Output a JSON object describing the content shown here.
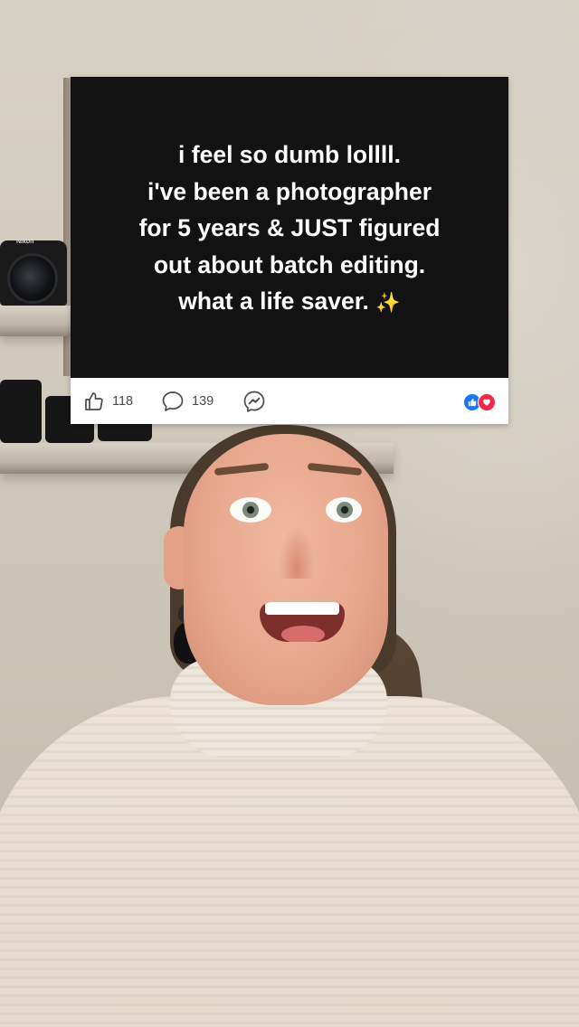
{
  "post": {
    "lines": [
      "i feel so dumb lollll.",
      "i've been a photographer",
      "for 5 years & JUST figured",
      "out about batch editing.",
      "what a life saver."
    ],
    "emoji": "✨",
    "likes": "118",
    "comments": "139"
  },
  "colors": {
    "post_bg": "#121212",
    "post_text": "#ffffff",
    "like_reaction": "#1877f2",
    "love_reaction": "#f02849"
  },
  "icons": {
    "like": "thumbs-up-icon",
    "comment": "comment-bubble-icon",
    "share": "messenger-icon",
    "reactions": [
      "like-reaction-icon",
      "love-reaction-icon"
    ]
  },
  "background": {
    "camera_brand": "Nikon"
  }
}
